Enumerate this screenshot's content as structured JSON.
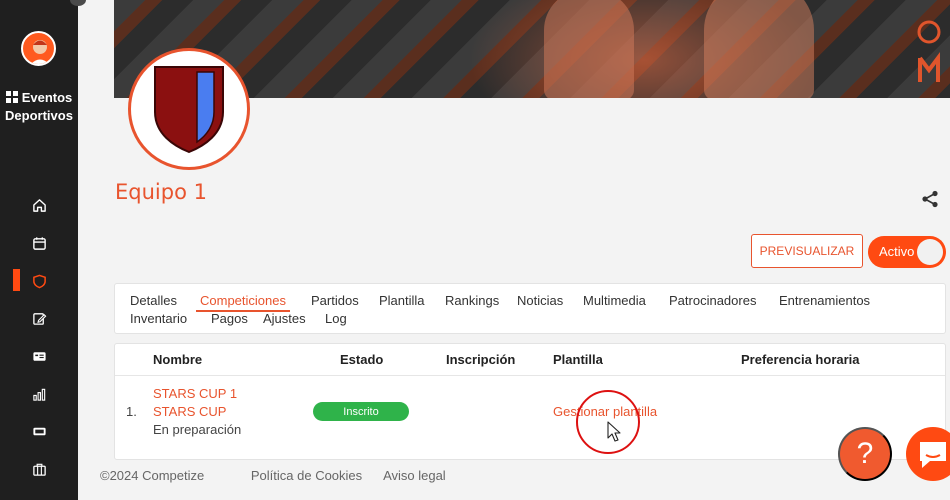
{
  "sidebar": {
    "brand_line1": "Eventos",
    "brand_line2": "Deportivos",
    "nav": [
      {
        "icon": "home-icon"
      },
      {
        "icon": "calendar-icon"
      },
      {
        "icon": "shield-icon",
        "active": true
      },
      {
        "icon": "edit-icon"
      },
      {
        "icon": "id-card-icon"
      },
      {
        "icon": "bar-chart-icon"
      },
      {
        "icon": "ticket-icon"
      },
      {
        "icon": "briefcase-icon"
      }
    ]
  },
  "team": {
    "name": "Equipo 1"
  },
  "actions": {
    "preview_label": "PREVISUALIZAR",
    "status_label": "Activo"
  },
  "tabs": [
    "Detalles",
    "Competiciones",
    "Partidos",
    "Plantilla",
    "Rankings",
    "Noticias",
    "Multimedia",
    "Patrocinadores",
    "Entrenamientos",
    "Inventario",
    "Pagos",
    "Ajustes",
    "Log"
  ],
  "active_tab": "Competiciones",
  "table": {
    "headers": {
      "nombre": "Nombre",
      "estado": "Estado",
      "inscripcion": "Inscripción",
      "plantilla": "Plantilla",
      "preferencia": "Preferencia horaria"
    },
    "rows": [
      {
        "index": "1.",
        "competition": "STARS CUP 1",
        "event": "STARS CUP",
        "stage": "En preparación",
        "estado": "Inscrito",
        "plantilla_link": "Gestionar plantilla"
      }
    ]
  },
  "footer": {
    "copyright": "©2024 Competize",
    "cookies": "Política de Cookies",
    "legal": "Aviso legal"
  },
  "help": {
    "label": "?"
  },
  "colors": {
    "accent": "#e8542e",
    "sidebar": "#1f1f1f",
    "badge_green": "#2fb34a"
  }
}
